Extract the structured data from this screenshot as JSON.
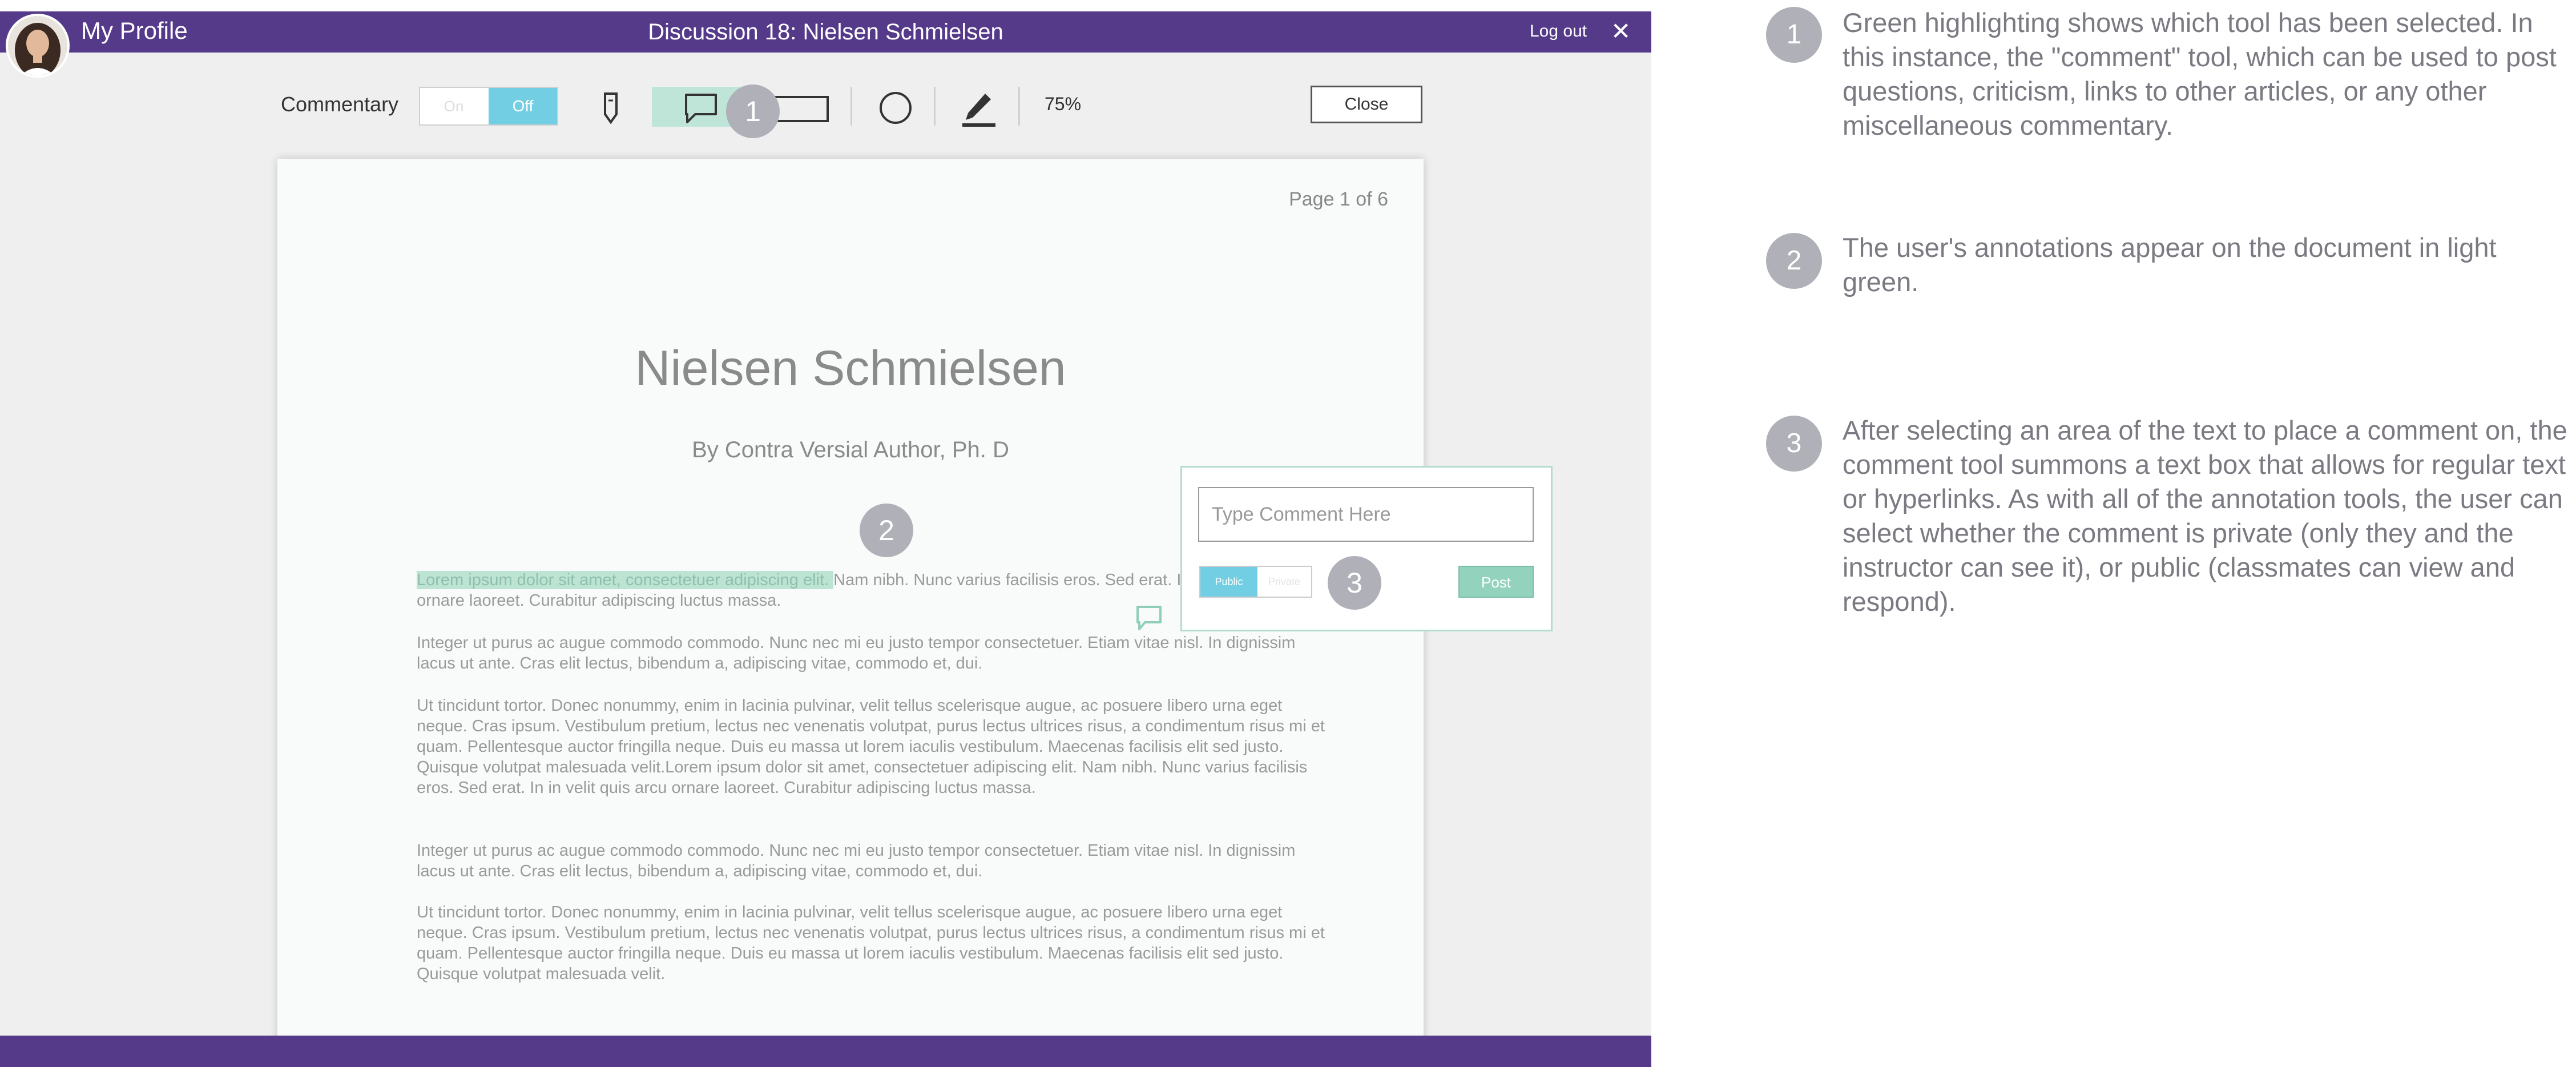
{
  "header": {
    "profile_label": "My Profile",
    "title": "Discussion 18: Nielsen Schmielsen",
    "logout_label": "Log out",
    "close_glyph": "✕"
  },
  "toolbar": {
    "commentary_label": "Commentary",
    "toggle_on": "On",
    "toggle_off": "Off",
    "zoom": "75%",
    "close_label": "Close",
    "tools": [
      "pin-icon",
      "comment-icon",
      "rectangle-icon",
      "circle-icon",
      "marker-icon"
    ],
    "selected_tool": "comment-icon"
  },
  "document": {
    "page_indicator": "Page 1 of 6",
    "heading": "Nielsen Schmielsen",
    "byline": "By Contra Versial Author, Ph. D",
    "highlighted": "Lorem ipsum dolor sit amet, consectetuer adipiscing elit. ",
    "p1_rest": "Nam nibh. Nunc varius facilisis eros. Sed erat. In in velit quis arcu ornare laoreet. Curabitur adipiscing luctus massa.",
    "paragraphs": [
      "Integer ut purus ac augue commodo commodo. Nunc nec mi eu justo tempor consectetuer. Etiam vitae nisl. In dignissim lacus ut ante. Cras elit lectus, bibendum a, adipiscing vitae, commodo et, dui.",
      "Ut tincidunt tortor. Donec nonummy, enim in lacinia pulvinar, velit tellus scelerisque augue, ac posuere libero urna eget neque. Cras ipsum. Vestibulum pretium, lectus nec venenatis volutpat, purus lectus ultrices risus, a condimentum risus mi et quam. Pellentesque auctor fringilla neque. Duis eu massa ut lorem iaculis vestibulum. Maecenas facilisis elit sed justo. Quisque volutpat malesuada velit.Lorem ipsum dolor sit amet, consectetuer adipiscing elit. Nam nibh. Nunc varius facilisis eros. Sed erat. In in velit quis arcu ornare laoreet. Curabitur adipiscing luctus massa.",
      "Integer ut purus ac augue commodo commodo. Nunc nec mi eu justo tempor consectetuer. Etiam vitae nisl. In dignissim lacus ut ante. Cras elit lectus, bibendum a, adipiscing vitae, commodo et, dui.",
      "Ut tincidunt tortor. Donec nonummy, enim in lacinia pulvinar, velit tellus scelerisque augue, ac posuere libero urna eget neque. Cras ipsum. Vestibulum pretium, lectus nec venenatis volutpat, purus lectus ultrices risus, a condimentum risus mi et quam. Pellentesque auctor fringilla neque. Duis eu massa ut lorem iaculis vestibulum. Maecenas facilisis elit sed justo. Quisque volutpat malesuada velit."
    ]
  },
  "comment_popup": {
    "placeholder": "Type Comment Here",
    "public_label": "Public",
    "private_label": "Private",
    "post_label": "Post"
  },
  "markers": [
    "1",
    "2",
    "3"
  ],
  "annotations": [
    {
      "num": "1",
      "text": "Green highlighting shows which tool has been selected. In this instance, the \"comment\" tool, which can be used to post questions, criticism, links to other articles, or any other miscellaneous commentary."
    },
    {
      "num": "2",
      "text": "The user's annotations appear on the document in light green."
    },
    {
      "num": "3",
      "text": "After selecting an area of the text to place a comment on, the comment tool summons a text box that allows for regular text or hyperlinks. As with all of the annotation tools, the user can select whether the comment is private (only they and the instructor can see it), or public (classmates can view and respond)."
    }
  ],
  "colors": {
    "header_purple": "#553a8a",
    "toggle_blue": "#72cfe3",
    "highlight_green": "#bde3d3",
    "post_green": "#93d3bd",
    "marker_gray": "#b0b0b8"
  }
}
